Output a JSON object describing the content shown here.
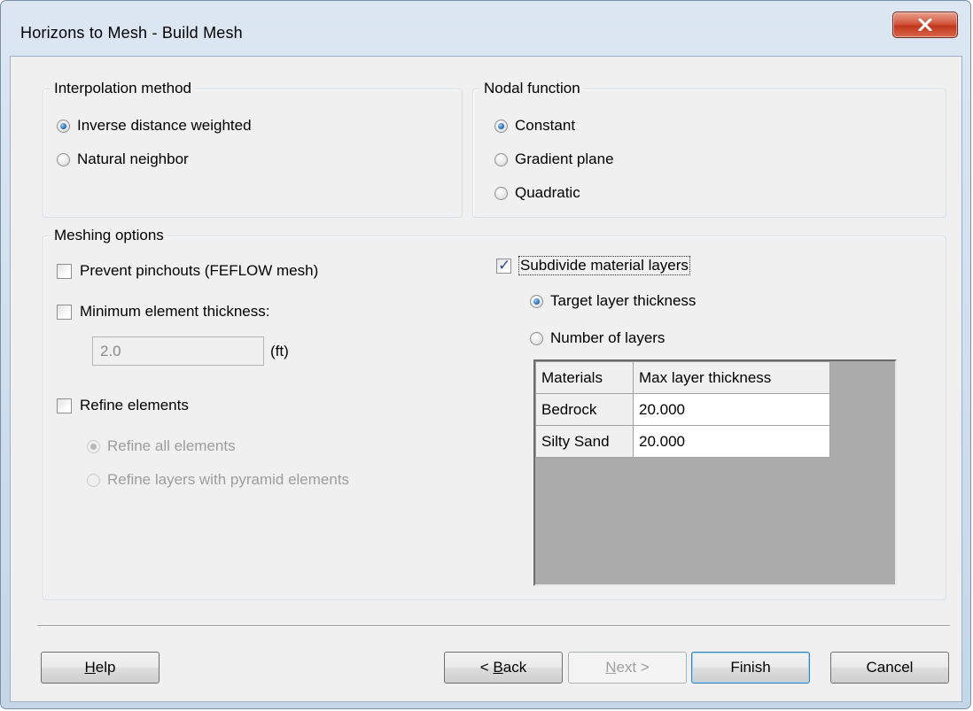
{
  "window": {
    "title": "Horizons to Mesh - Build Mesh"
  },
  "interpolation": {
    "label": "Interpolation method",
    "options": [
      "Inverse distance weighted",
      "Natural neighbor"
    ],
    "selected": 0
  },
  "nodal": {
    "label": "Nodal function",
    "options": [
      "Constant",
      "Gradient plane",
      "Quadratic"
    ],
    "selected": 0
  },
  "meshing": {
    "label": "Meshing options",
    "prevent_pinchouts": {
      "label": "Prevent pinchouts (FEFLOW mesh)",
      "checked": false
    },
    "min_thickness": {
      "label": "Minimum element thickness:",
      "checked": false,
      "value": "2.0",
      "unit": "(ft)"
    },
    "refine": {
      "label": "Refine elements",
      "checked": false,
      "options": [
        "Refine all elements",
        "Refine layers with pyramid elements"
      ]
    },
    "subdivide": {
      "label": "Subdivide material layers",
      "checked": true,
      "options": [
        "Target layer thickness",
        "Number of layers"
      ],
      "selected": 0
    },
    "table": {
      "headers": [
        "Materials",
        "Max layer thickness"
      ],
      "rows": [
        {
          "material": "Bedrock",
          "thickness": "20.000"
        },
        {
          "material": "Silty Sand",
          "thickness": "20.000"
        }
      ]
    }
  },
  "buttons": {
    "help": {
      "ul": "H",
      "rest": "elp"
    },
    "back": {
      "pre": "< ",
      "ul": "B",
      "rest": "ack"
    },
    "next": {
      "ul": "N",
      "rest": "ext >"
    },
    "finish": "Finish",
    "cancel": "Cancel"
  }
}
